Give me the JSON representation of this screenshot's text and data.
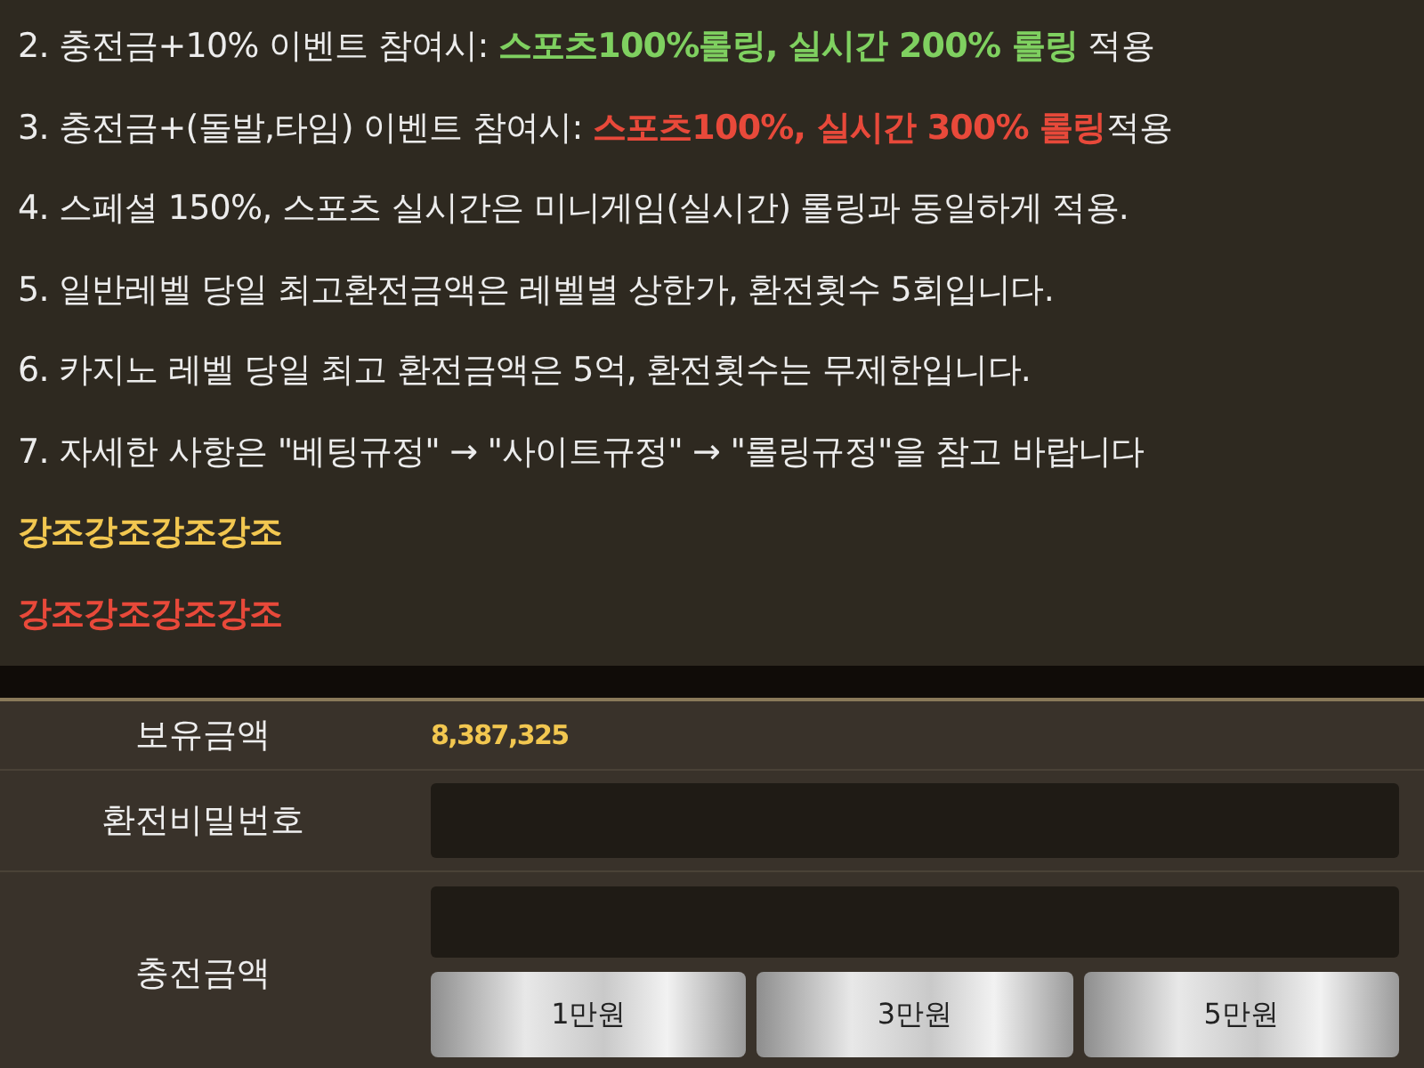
{
  "notices": [
    {
      "parts": [
        {
          "text": "2. 충전금+10% 이벤트 참여시: "
        },
        {
          "text": "스포츠100%롤링, 실시간 200% 롤링",
          "color": "#7fd060"
        },
        {
          "text": " 적용"
        }
      ]
    },
    {
      "parts": [
        {
          "text": "3. 충전금+(돌발,타임) 이벤트 참여시: "
        },
        {
          "text": "스포츠100%, 실시간 300% 롤링",
          "color": "#e8493a"
        },
        {
          "text": "적용"
        }
      ]
    },
    {
      "parts": [
        {
          "text": "4. 스페셜 150%, 스포츠 실시간은 미니게임(실시간) 롤링과 동일하게 적용."
        }
      ]
    },
    {
      "parts": [
        {
          "text": "5. 일반레벨 당일 최고환전금액은 레벨별 상한가, 환전횟수 5회입니다."
        }
      ]
    },
    {
      "parts": [
        {
          "text": "6. 카지노 레벨 당일 최고 환전금액은 5억, 환전횟수는 무제한입니다."
        }
      ]
    },
    {
      "parts": [
        {
          "text": "7. 자세한 사항은 \"베팅규정\" → \"사이트규정\" → \"롤링규정\"을 참고 바랍니다"
        }
      ]
    },
    {
      "parts": [
        {
          "text": "강조강조강조강조",
          "color": "#f2c750"
        }
      ]
    },
    {
      "parts": [
        {
          "text": "강조강조강조강조",
          "color": "#e8493a"
        }
      ]
    }
  ],
  "form": {
    "balance": {
      "label": "보유금액",
      "value": "8,387,325"
    },
    "password": {
      "label": "환전비밀번호"
    },
    "amount": {
      "label": "충전금액",
      "buttons": [
        "1만원",
        "3만원",
        "5만원"
      ]
    }
  }
}
